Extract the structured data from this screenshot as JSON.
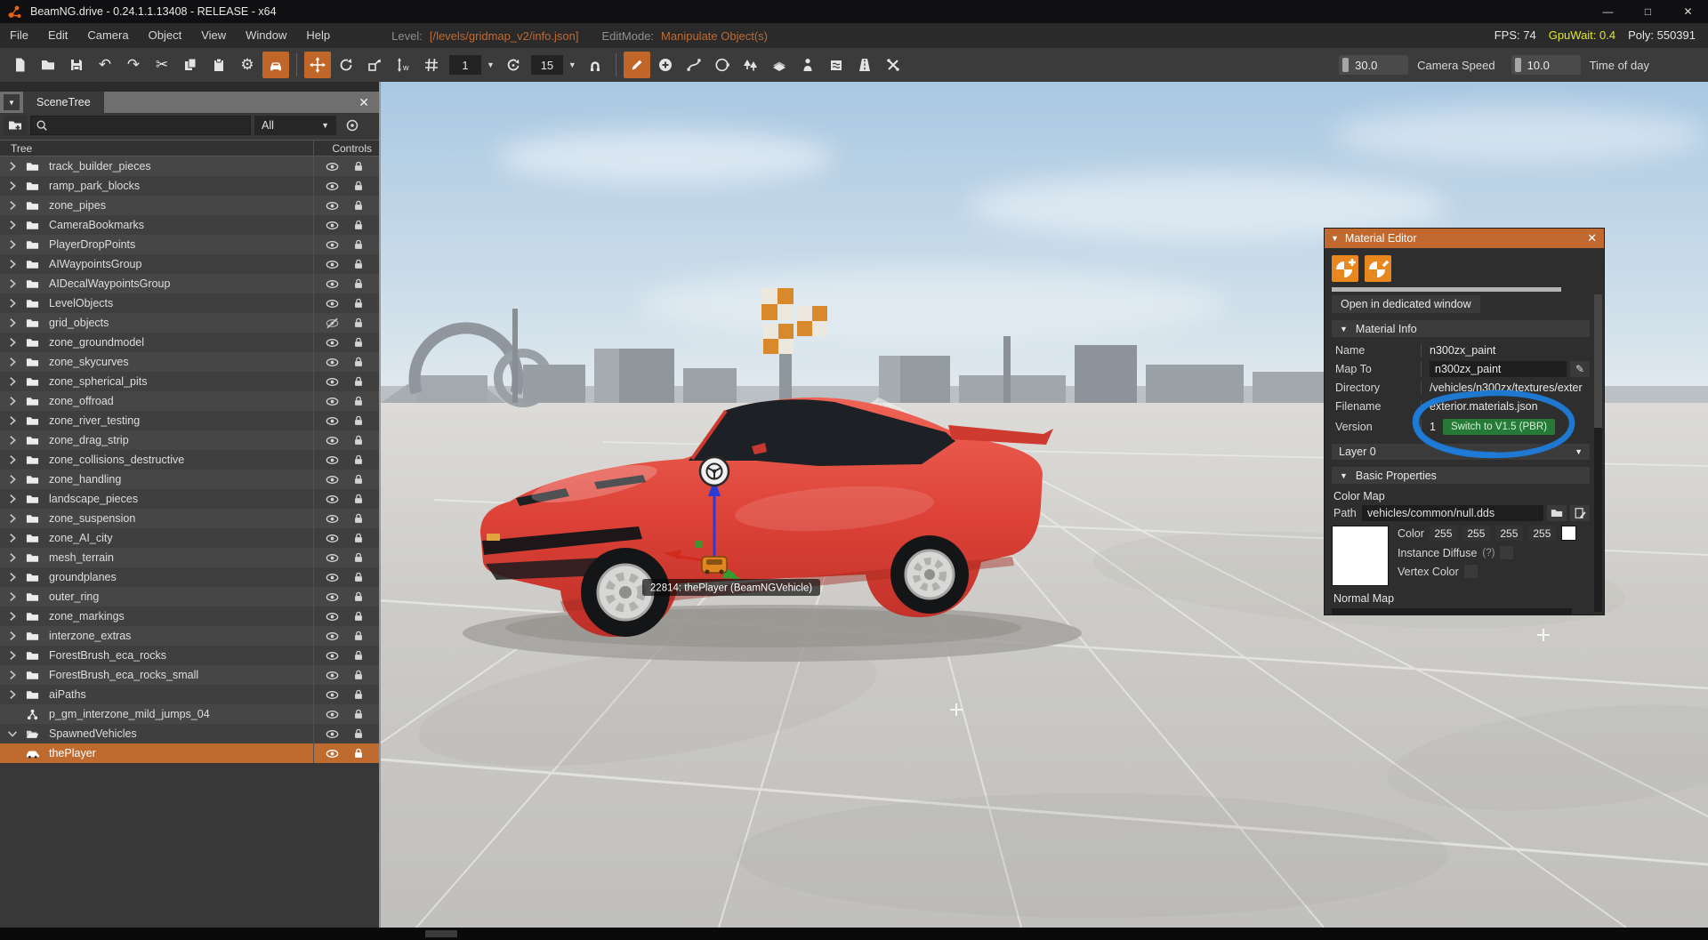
{
  "window": {
    "title": "BeamNG.drive - 0.24.1.1.13408 - RELEASE - x64",
    "minimize": "—",
    "maximize": "□",
    "close": "✕"
  },
  "menubar": {
    "items": [
      "File",
      "Edit",
      "Camera",
      "Object",
      "View",
      "Window",
      "Help"
    ],
    "level_label": "Level:",
    "level_value": "[/levels/gridmap_v2/info.json]",
    "editmode_label": "EditMode:",
    "editmode_value": "Manipulate Object(s)",
    "fps_label": "FPS: 74",
    "gpuwait_label": "GpuWait: 0.4",
    "poly_label": "Poly: 550391"
  },
  "toolbar": {
    "translate_snap_value": "1",
    "rotate_snap_value": "15",
    "camera_speed_value": "30.0",
    "camera_speed_label": "Camera Speed",
    "time_of_day_value": "10.0",
    "time_of_day_label": "Time of day"
  },
  "scene_tree": {
    "tab": "SceneTree",
    "close": "✕",
    "filter_value": "All",
    "col_tree": "Tree",
    "col_controls": "Controls",
    "items": [
      {
        "label": "track_builder_pieces",
        "icon": "folder",
        "chevron": "right"
      },
      {
        "label": "ramp_park_blocks",
        "icon": "folder",
        "chevron": "right"
      },
      {
        "label": "zone_pipes",
        "icon": "folder",
        "chevron": "right"
      },
      {
        "label": "CameraBookmarks",
        "icon": "folder",
        "chevron": "right"
      },
      {
        "label": "PlayerDropPoints",
        "icon": "folder",
        "chevron": "right"
      },
      {
        "label": "AIWaypointsGroup",
        "icon": "folder",
        "chevron": "right"
      },
      {
        "label": "AIDecalWaypointsGroup",
        "icon": "folder",
        "chevron": "right"
      },
      {
        "label": "LevelObjects",
        "icon": "folder",
        "chevron": "right"
      },
      {
        "label": "grid_objects",
        "icon": "folder",
        "chevron": "right",
        "hidden": true
      },
      {
        "label": "zone_groundmodel",
        "icon": "folder",
        "chevron": "right"
      },
      {
        "label": "zone_skycurves",
        "icon": "folder",
        "chevron": "right"
      },
      {
        "label": "zone_spherical_pits",
        "icon": "folder",
        "chevron": "right"
      },
      {
        "label": "zone_offroad",
        "icon": "folder",
        "chevron": "right"
      },
      {
        "label": "zone_river_testing",
        "icon": "folder",
        "chevron": "right"
      },
      {
        "label": "zone_drag_strip",
        "icon": "folder",
        "chevron": "right"
      },
      {
        "label": "zone_collisions_destructive",
        "icon": "folder",
        "chevron": "right"
      },
      {
        "label": "zone_handling",
        "icon": "folder",
        "chevron": "right"
      },
      {
        "label": "landscape_pieces",
        "icon": "folder",
        "chevron": "right"
      },
      {
        "label": "zone_suspension",
        "icon": "folder",
        "chevron": "right"
      },
      {
        "label": "zone_AI_city",
        "icon": "folder",
        "chevron": "right"
      },
      {
        "label": "mesh_terrain",
        "icon": "folder",
        "chevron": "right"
      },
      {
        "label": "groundplanes",
        "icon": "folder",
        "chevron": "right"
      },
      {
        "label": "outer_ring",
        "icon": "folder",
        "chevron": "right"
      },
      {
        "label": "zone_markings",
        "icon": "folder",
        "chevron": "right"
      },
      {
        "label": "interzone_extras",
        "icon": "folder",
        "chevron": "right"
      },
      {
        "label": "ForestBrush_eca_rocks",
        "icon": "folder",
        "chevron": "right"
      },
      {
        "label": "ForestBrush_eca_rocks_small",
        "icon": "folder",
        "chevron": "right"
      },
      {
        "label": "aiPaths",
        "icon": "folder",
        "chevron": "right"
      },
      {
        "label": "p_gm_interzone_mild_jumps_04",
        "icon": "prefab",
        "chevron": "none"
      },
      {
        "label": "SpawnedVehicles",
        "icon": "folder-open",
        "chevron": "down"
      },
      {
        "label": "thePlayer",
        "icon": "car",
        "chevron": "none",
        "selected": true
      }
    ]
  },
  "viewport": {
    "selection_label": "22814: thePlayer (BeamNGVehicle)"
  },
  "material_editor": {
    "title": "Material Editor",
    "close": "✕",
    "open_window_btn": "Open in dedicated window",
    "section_material_info": "Material Info",
    "name_label": "Name",
    "name_value": "n300zx_paint",
    "map_to_label": "Map To",
    "map_to_value": "n300zx_paint",
    "directory_label": "Directory",
    "directory_value": "/vehicles/n300zx/textures/exter",
    "filename_label": "Filename",
    "filename_value": "exterior.materials.json",
    "version_label": "Version",
    "version_value": "1",
    "switch_btn": "Switch to V1.5 (PBR)",
    "layer_bar": "Layer 0",
    "section_basic": "Basic Properties",
    "color_map_label": "Color Map",
    "path_label": "Path",
    "path_value": "vehicles/common/null.dds",
    "color_label": "Color",
    "color_r": "255",
    "color_g": "255",
    "color_b": "255",
    "color_a": "255",
    "instance_diffuse_label": "Instance Diffuse",
    "instance_diffuse_hint": "(?)",
    "vertex_color_label": "Vertex Color",
    "normal_map_label": "Normal Map",
    "accent_color": "#c1682f",
    "switch_btn_color": "#247a36",
    "annotation_color": "#1e7cd9"
  }
}
